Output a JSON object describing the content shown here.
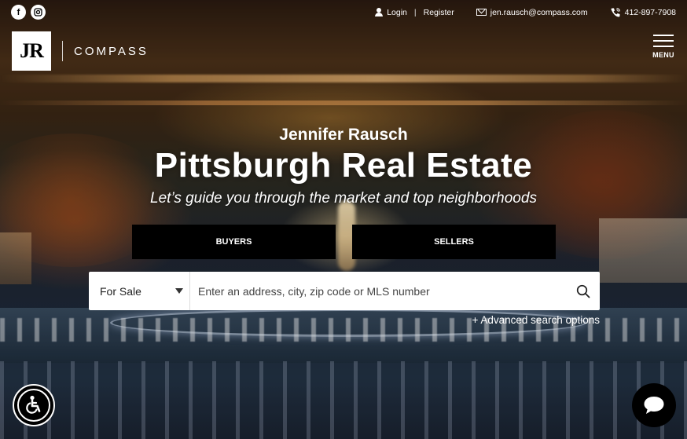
{
  "social": {
    "facebook": "f"
  },
  "topbar": {
    "login": "Login",
    "separator": "|",
    "register": "Register",
    "email": "jen.rausch@compass.com",
    "phone": "412-897-7908"
  },
  "logo": {
    "initials": "JR",
    "brand": "COMPASS"
  },
  "menu": {
    "label": "MENU"
  },
  "hero": {
    "agent_name": "Jennifer Rausch",
    "title": "Pittsburgh Real Estate",
    "tagline": "Let’s guide you through the market and top neighborhoods"
  },
  "cta": {
    "buyers": "BUYERS",
    "sellers": "SELLERS"
  },
  "search": {
    "type_value": "For Sale",
    "placeholder": "Enter an address, city, zip code or MLS number",
    "advanced": "+ Advanced search options"
  },
  "icons": {
    "facebook": "facebook-icon",
    "instagram": "instagram-icon",
    "user": "user-icon",
    "mail": "mail-icon",
    "phone": "phone-icon",
    "menu": "hamburger-icon",
    "search": "search-icon",
    "accessibility": "accessibility-icon",
    "chat": "chat-icon"
  }
}
